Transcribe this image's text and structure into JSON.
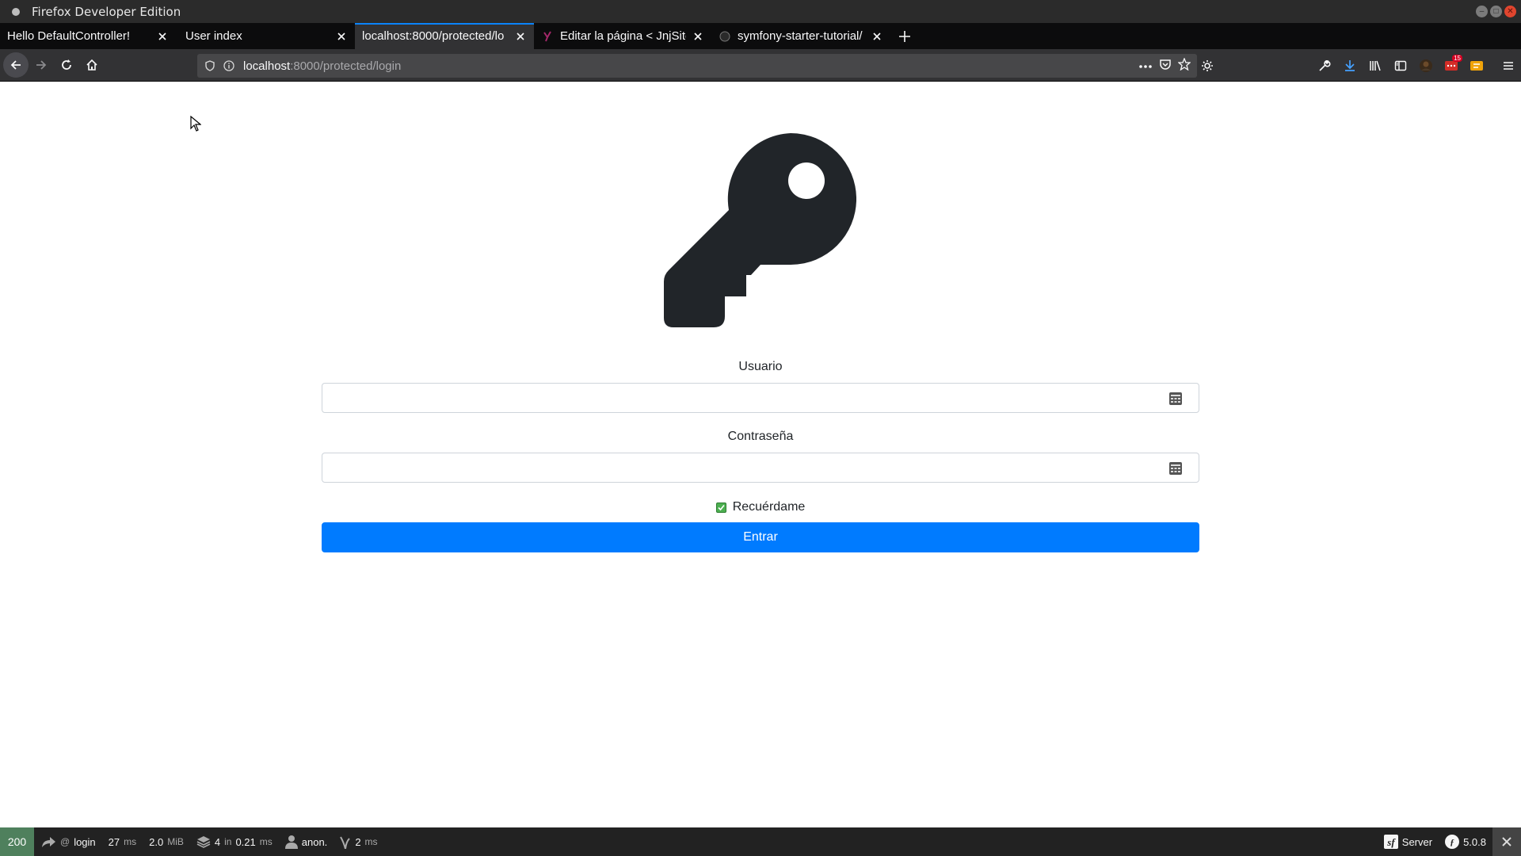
{
  "window": {
    "title": "Firefox Developer Edition"
  },
  "tabs": [
    {
      "label": "Hello DefaultController!",
      "active": false
    },
    {
      "label": "User index",
      "active": false
    },
    {
      "label": "localhost:8000/protected/lo",
      "active": true
    },
    {
      "label": "Editar la página < JnjSite",
      "active": false
    },
    {
      "label": "symfony-starter-tutorial/",
      "active": false
    }
  ],
  "urlbar": {
    "host": "localhost",
    "path": ":8000/protected/login"
  },
  "toolbar": {
    "notifications_badge": "15"
  },
  "login": {
    "username_label": "Usuario",
    "username_value": "",
    "password_label": "Contraseña",
    "password_value": "",
    "remember_label": "Recuérdame",
    "remember_checked": true,
    "submit_label": "Entrar",
    "logo_icon": "key-icon"
  },
  "profiler": {
    "status_code": "200",
    "route": "login",
    "route_prefix": "@",
    "time_value": "27",
    "time_unit": "ms",
    "memory_value": "2.0",
    "memory_unit": "MiB",
    "db_queries": "4",
    "db_in": "in",
    "db_time": "0.21",
    "db_unit": "ms",
    "user": "anon.",
    "twig_time": "2",
    "twig_unit": "ms",
    "server_label": "Server",
    "symfony_version": "5.0.8"
  },
  "colors": {
    "primary": "#007bff",
    "status_ok": "#4f805d",
    "tab_accent": "#0a84ff"
  }
}
